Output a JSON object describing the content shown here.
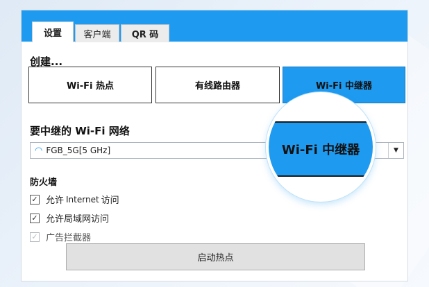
{
  "tabs": [
    {
      "label": "设置"
    },
    {
      "label": "客户端"
    },
    {
      "label": "QR 码"
    }
  ],
  "create": {
    "title": "创建...",
    "options": [
      {
        "label": "Wi-Fi 热点"
      },
      {
        "label": "有线路由器"
      },
      {
        "label": "Wi-Fi 中继器"
      }
    ],
    "selected_index": 2
  },
  "network": {
    "title": "要中继的 Wi-Fi 网络",
    "selected_value": "FGB_5G[5 GHz]",
    "icon": "wifi-icon"
  },
  "firewall": {
    "title": "防火墙",
    "options": [
      {
        "label_prefix": "允许",
        "label_en": "Internet",
        "label_suffix": "访问",
        "checked": true
      },
      {
        "label": "允许局域网访问",
        "checked": true
      },
      {
        "label": "广告拦截器",
        "checked": true,
        "disabled": true
      }
    ]
  },
  "start_button": {
    "label": "启动热点"
  },
  "magnifier": {
    "label": "Wi-Fi 中继器"
  },
  "colors": {
    "accent": "#1e9bf0"
  }
}
